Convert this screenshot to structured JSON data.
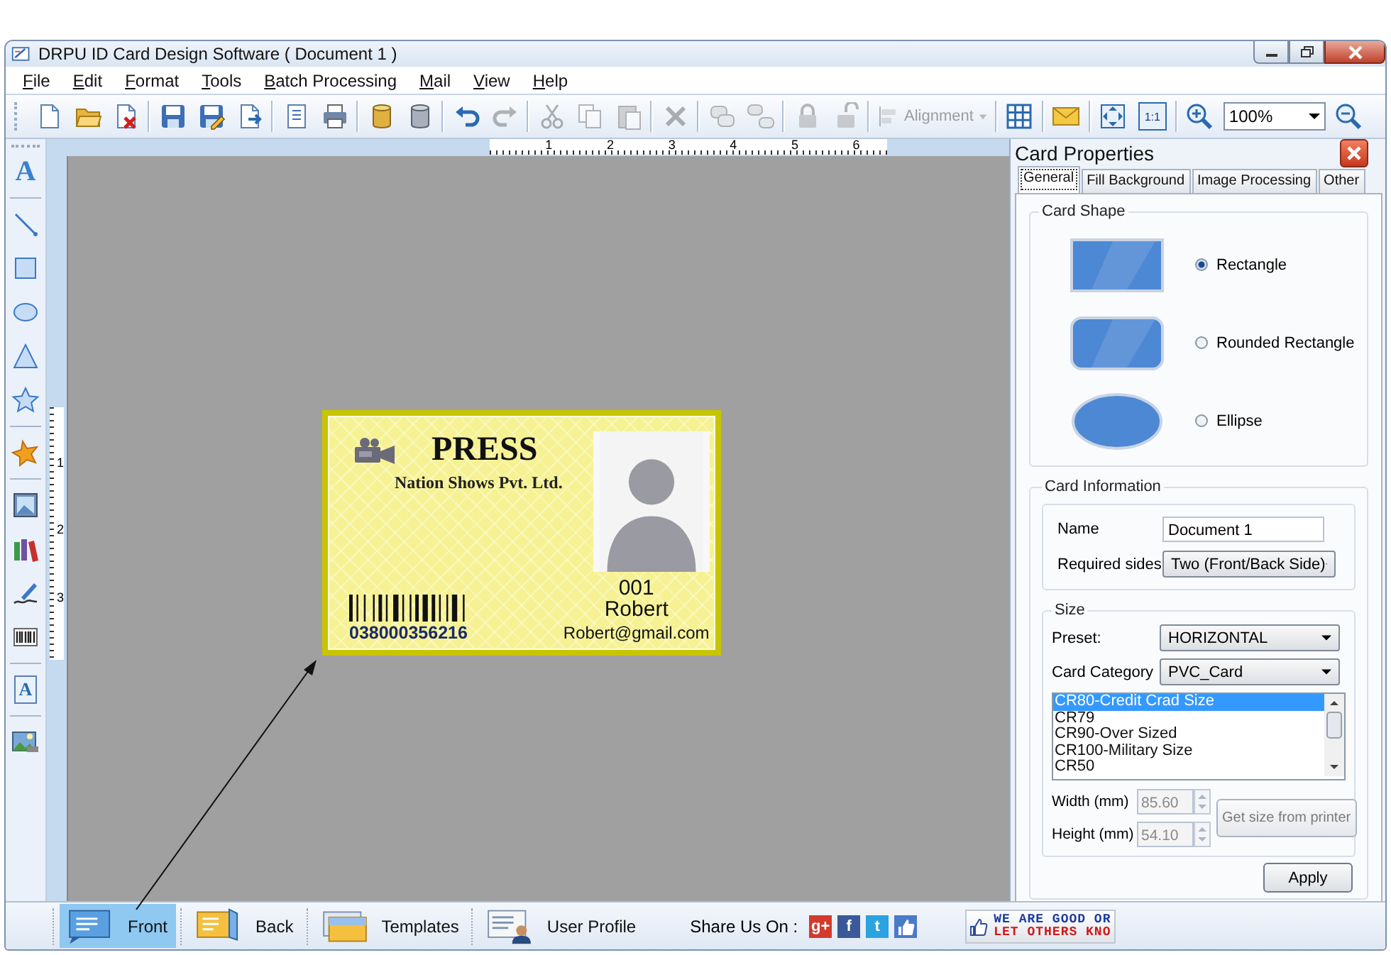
{
  "window": {
    "title": "DRPU ID Card Design Software ( Document 1 )"
  },
  "menu": [
    "File",
    "Edit",
    "Format",
    "Tools",
    "Batch Processing",
    "Mail",
    "View",
    "Help"
  ],
  "toolbar": [
    {
      "kind": "new",
      "disabled": false
    },
    {
      "kind": "open",
      "disabled": false
    },
    {
      "kind": "close-doc",
      "disabled": false
    },
    {
      "kind": "separator"
    },
    {
      "kind": "save",
      "disabled": false
    },
    {
      "kind": "save-as",
      "disabled": false
    },
    {
      "kind": "export",
      "disabled": false
    },
    {
      "kind": "separator"
    },
    {
      "kind": "properties",
      "disabled": false
    },
    {
      "kind": "print",
      "disabled": false
    },
    {
      "kind": "separator"
    },
    {
      "kind": "db-gold",
      "disabled": false
    },
    {
      "kind": "db",
      "disabled": false
    },
    {
      "kind": "separator"
    },
    {
      "kind": "undo",
      "disabled": false
    },
    {
      "kind": "redo",
      "disabled": true
    },
    {
      "kind": "separator"
    },
    {
      "kind": "cut",
      "disabled": true
    },
    {
      "kind": "copy",
      "disabled": true
    },
    {
      "kind": "paste",
      "disabled": true
    },
    {
      "kind": "separator"
    },
    {
      "kind": "delete",
      "disabled": true
    },
    {
      "kind": "separator"
    },
    {
      "kind": "group",
      "disabled": true
    },
    {
      "kind": "ungroup",
      "disabled": true
    },
    {
      "kind": "separator"
    },
    {
      "kind": "lock",
      "disabled": true
    },
    {
      "kind": "unlock",
      "disabled": true
    },
    {
      "kind": "separator"
    },
    {
      "kind": "dropdown",
      "label": "Alignment",
      "disabled": true
    },
    {
      "kind": "separator"
    },
    {
      "kind": "grid",
      "disabled": false
    },
    {
      "kind": "separator"
    },
    {
      "kind": "mail",
      "disabled": false
    },
    {
      "kind": "separator"
    },
    {
      "kind": "fit",
      "disabled": false
    },
    {
      "kind": "ratio",
      "label": "1:1",
      "disabled": false
    },
    {
      "kind": "separator"
    },
    {
      "kind": "zoom-in",
      "disabled": false
    },
    {
      "kind": "zoom-combo",
      "value": "100%"
    },
    {
      "kind": "zoom-out",
      "disabled": false
    }
  ],
  "toolbox": [
    {
      "kind": "text",
      "label": "A"
    },
    {
      "kind": "separator"
    },
    {
      "kind": "line"
    },
    {
      "kind": "rectangle"
    },
    {
      "kind": "ellipse"
    },
    {
      "kind": "triangle"
    },
    {
      "kind": "star"
    },
    {
      "kind": "separator"
    },
    {
      "kind": "blob"
    },
    {
      "kind": "separator"
    },
    {
      "kind": "image"
    },
    {
      "kind": "books"
    },
    {
      "kind": "signature"
    },
    {
      "kind": "barcode"
    },
    {
      "kind": "separator"
    },
    {
      "kind": "watermark",
      "label": "A"
    },
    {
      "kind": "separator"
    },
    {
      "kind": "picture"
    }
  ],
  "rulers": {
    "horizontal": [
      "1",
      "2",
      "3",
      "4",
      "5",
      "6"
    ],
    "vertical": [
      "1",
      "2",
      "3"
    ]
  },
  "card": {
    "title": "PRESS",
    "company": "Nation Shows Pvt. Ltd.",
    "id": "001",
    "name": "Robert",
    "email": "Robert@gmail.com",
    "barcode_number": "038000356216"
  },
  "panel": {
    "title": "Card Properties",
    "tabs": [
      {
        "label": "General",
        "selected": true
      },
      {
        "label": "Fill Background",
        "selected": false
      },
      {
        "label": "Image Processing",
        "selected": false
      },
      {
        "label": "Other",
        "selected": false
      }
    ],
    "card_shape": {
      "title": "Card Shape",
      "options": [
        {
          "kind": "rectangle",
          "label": "Rectangle",
          "selected": true
        },
        {
          "kind": "rounded",
          "label": "Rounded Rectangle",
          "selected": false
        },
        {
          "kind": "ellipse",
          "label": "Ellipse",
          "selected": false
        }
      ]
    },
    "card_information": {
      "title": "Card Information",
      "name_label": "Name",
      "name_value": "Document 1",
      "sides_label": "Required sides",
      "sides_value": "Two (Front/Back Side)",
      "size": {
        "title": "Size",
        "preset_label": "Preset:",
        "preset_value": "HORIZONTAL",
        "category_label": "Card Category",
        "category_value": "PVC_Card",
        "sizes": [
          {
            "label": "CR80-Credit Crad Size",
            "selected": true
          },
          {
            "label": "CR79",
            "selected": false
          },
          {
            "label": "CR90-Over Sized",
            "selected": false
          },
          {
            "label": "CR100-Military Size",
            "selected": false
          },
          {
            "label": "CR50",
            "selected": false
          }
        ],
        "width": {
          "label": "Width (mm)",
          "value": "85.60",
          "disabled": true
        },
        "height": {
          "label": "Height (mm)",
          "value": "54.10",
          "disabled": true
        },
        "printer_button": {
          "label": "Get size from printer",
          "disabled": true
        }
      },
      "apply_button": "Apply"
    }
  },
  "bottom_bar": {
    "tabs": [
      {
        "kind": "front",
        "label": "Front",
        "selected": true
      },
      {
        "kind": "back",
        "label": "Back",
        "selected": false
      },
      {
        "kind": "templates",
        "label": "Templates",
        "selected": false
      },
      {
        "kind": "profile",
        "label": "User Profile",
        "selected": false
      }
    ],
    "share_label": "Share Us On :",
    "social": [
      {
        "kind": "google",
        "label": "g+"
      },
      {
        "kind": "facebook",
        "label": "f"
      },
      {
        "kind": "twitter",
        "label": "t"
      },
      {
        "kind": "like"
      }
    ],
    "banner": [
      "WE ARE GOOD OR",
      "LET OTHERS KNO"
    ]
  }
}
